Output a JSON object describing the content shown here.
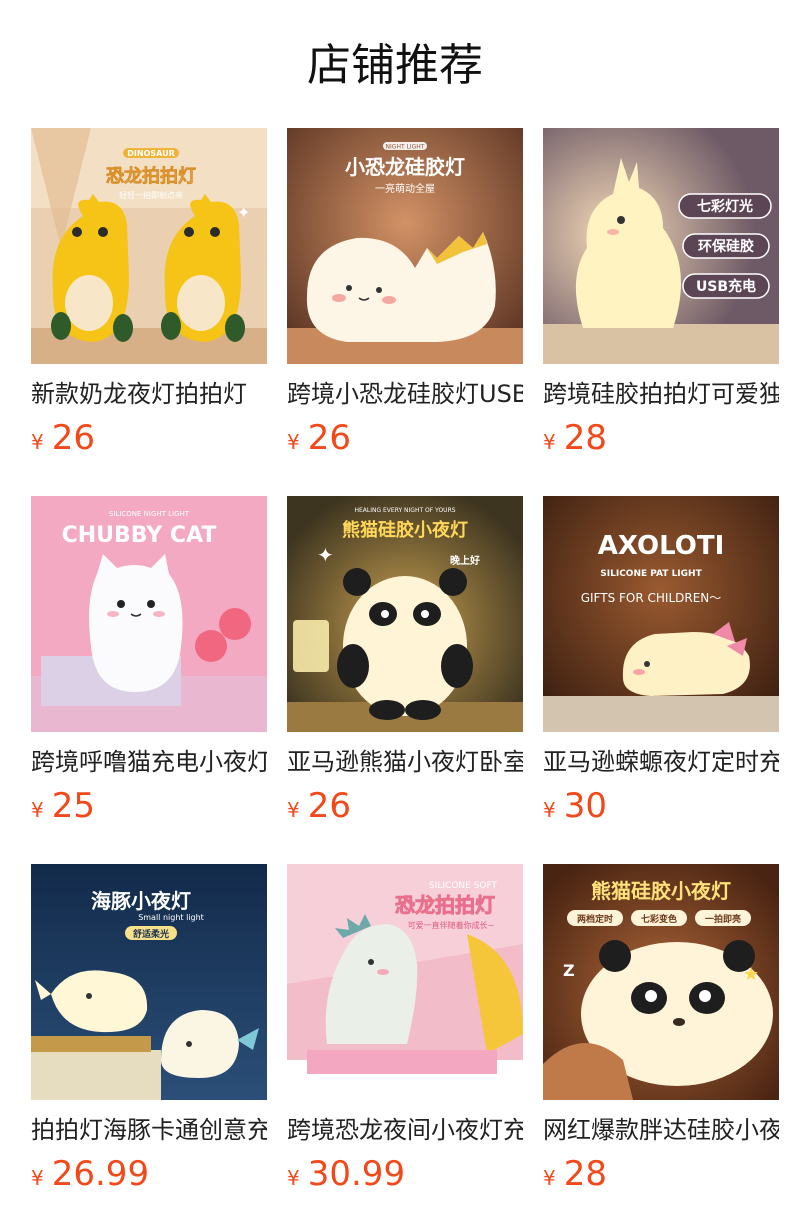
{
  "header": {
    "title": "店铺推荐"
  },
  "products": [
    {
      "name": "新款奶龙夜灯拍拍灯",
      "currency": "¥",
      "price": "26",
      "image": {
        "icon": "yellow-dinosaur-lamp-image",
        "title": "恐龙拍拍灯",
        "tag": "DINOSAUR",
        "subtitle": "轻轻一拍即刻点亮",
        "bg": "#e9c9a3",
        "accent": "#f5c400"
      }
    },
    {
      "name": "跨境小恐龙硅胶灯USB",
      "currency": "¥",
      "price": "26",
      "image": {
        "icon": "white-dinosaur-lamp-image",
        "title": "小恐龙硅胶灯",
        "tag": "NIGHT LIGHT",
        "subtitle": "一亮萌动全屋",
        "bg": "#8c5a3c",
        "accent": "#fbf1e0"
      }
    },
    {
      "name": "跨境硅胶拍拍灯可爱独角兽",
      "currency": "¥",
      "price": "28",
      "image": {
        "icon": "unicorn-lamp-image",
        "badges": [
          "七彩灯光",
          "环保硅胶",
          "USB充电"
        ],
        "bg": "#a8867a",
        "accent": "#fff2c0"
      }
    },
    {
      "name": "跨境呼噜猫充电小夜灯",
      "currency": "¥",
      "price": "25",
      "image": {
        "icon": "white-cat-lamp-image",
        "tag": "SILICONE NIGHT LIGHT",
        "title": "CHUBBY CAT",
        "bg": "#f3a9c2",
        "accent": "#ffffff"
      }
    },
    {
      "name": "亚马逊熊猫小夜灯卧室",
      "currency": "¥",
      "price": "26",
      "image": {
        "icon": "panda-lamp-image",
        "tag": "HEALING EVERY NIGHT OF YOURS",
        "title": "熊猫硅胶小夜灯",
        "side": "晚上好",
        "bg": "#5a4a2a",
        "accent": "#fff6d8"
      }
    },
    {
      "name": "亚马逊蝾螈夜灯定时充电",
      "currency": "¥",
      "price": "30",
      "image": {
        "icon": "axolotl-lamp-image",
        "title": "AXOLOTI",
        "tag": "SILICONE PAT LIGHT",
        "subtitle": "GIFTS FOR CHILDREN～",
        "bg": "#6a3a1e",
        "accent": "#fff0c8"
      }
    },
    {
      "name": "拍拍灯海豚卡通创意充电",
      "currency": "¥",
      "price": "26.99",
      "image": {
        "icon": "dolphin-lamp-image",
        "title": "海豚小夜灯",
        "tag": "Small night light",
        "badge": "舒适柔光",
        "bg": "#1d3556",
        "accent": "#fff7d6"
      }
    },
    {
      "name": "跨境恐龙夜间小夜灯充电",
      "currency": "¥",
      "price": "30.99",
      "image": {
        "icon": "mint-dinosaur-lamp-image",
        "tag": "SILICONE SOFT",
        "title": "恐龙拍拍灯",
        "subtitle": "可爱一直伴随着你成长~",
        "bg": "#f0b8c6",
        "accent": "#f2efe6"
      }
    },
    {
      "name": "网红爆款胖达硅胶小夜灯",
      "currency": "¥",
      "price": "28",
      "image": {
        "icon": "panda-face-lamp-image",
        "title": "熊猫硅胶小夜灯",
        "badges": [
          "两档定时",
          "七彩变色",
          "一拍即亮"
        ],
        "bg": "#6b3a1c",
        "accent": "#fff3d8"
      }
    }
  ]
}
